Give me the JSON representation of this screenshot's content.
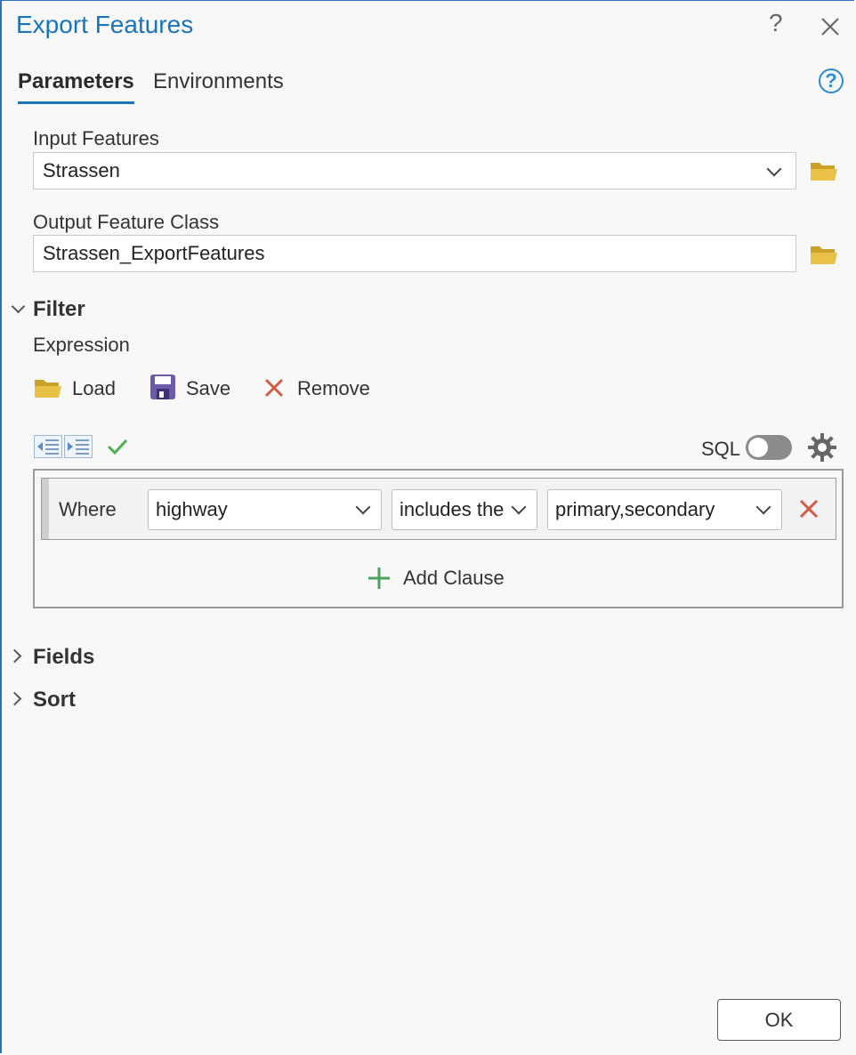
{
  "dialog": {
    "title": "Export Features",
    "help_glyph": "?",
    "close_glyph": "✕"
  },
  "tabs": [
    {
      "label": "Parameters",
      "active": true
    },
    {
      "label": "Environments",
      "active": false
    }
  ],
  "help_icon_glyph": "?",
  "input_features": {
    "label": "Input Features",
    "value": "Strassen",
    "icon": "folder-open-icon"
  },
  "output_feature_class": {
    "label": "Output Feature Class",
    "value": "Strassen_ExportFeatures",
    "icon": "folder-open-icon"
  },
  "filter": {
    "title": "Filter",
    "expression_label": "Expression",
    "tools": {
      "load": "Load",
      "save": "Save",
      "remove": "Remove"
    },
    "sql_label": "SQL",
    "sql_enabled": false,
    "clause": {
      "where": "Where",
      "field": "highway",
      "operator": "includes the",
      "value": "primary,secondary"
    },
    "add_clause": "Add Clause"
  },
  "sections": {
    "fields": "Fields",
    "sort": "Sort"
  },
  "ok_label": "OK",
  "colors": {
    "accent": "#1b73b8",
    "folder": "#e8c146",
    "remove_red": "#d35b3f",
    "check_green": "#4caf50",
    "add_green": "#4aa35a",
    "save_purple": "#6b5ba8"
  }
}
